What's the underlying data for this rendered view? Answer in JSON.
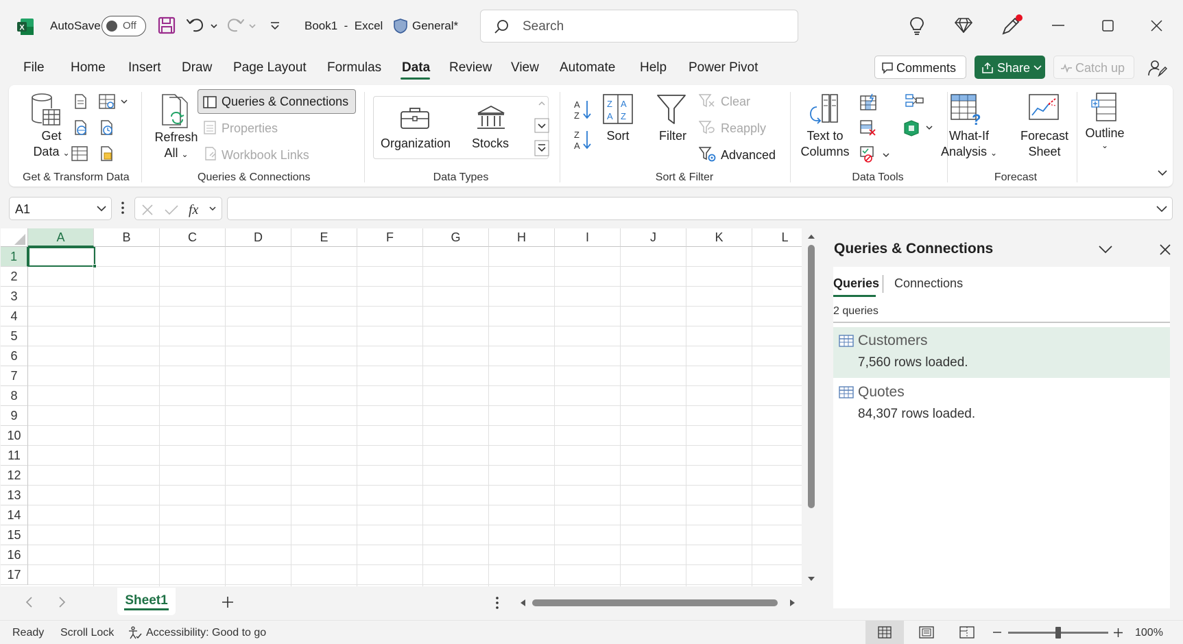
{
  "titlebar": {
    "autosave_label": "AutoSave",
    "autosave_state": "Off",
    "doc_title": "Book1  -  Excel",
    "sensitivity_label": "General*",
    "search_placeholder": "Search"
  },
  "menu": {
    "tabs": [
      "File",
      "Home",
      "Insert",
      "Draw",
      "Page Layout",
      "Formulas",
      "Data",
      "Review",
      "View",
      "Automate",
      "Help",
      "Power Pivot"
    ],
    "active_tab": "Data",
    "comments_label": "Comments",
    "share_label": "Share",
    "catchup_label": "Catch up"
  },
  "ribbon": {
    "get_data_line1": "Get",
    "get_data_line2": "Data",
    "refresh_line1": "Refresh",
    "refresh_line2": "All",
    "queries_connections": "Queries & Connections",
    "properties": "Properties",
    "workbook_links": "Workbook Links",
    "organization": "Organization",
    "stocks": "Stocks",
    "sort": "Sort",
    "filter": "Filter",
    "clear": "Clear",
    "reapply": "Reapply",
    "advanced": "Advanced",
    "text_to_columns_line1": "Text to",
    "text_to_columns_line2": "Columns",
    "whatif_line1": "What-If",
    "whatif_line2": "Analysis",
    "forecast_line1": "Forecast",
    "forecast_line2": "Sheet",
    "outline": "Outline",
    "groups": {
      "get_transform": "Get & Transform Data",
      "queries_connections": "Queries & Connections",
      "data_types": "Data Types",
      "sort_filter": "Sort & Filter",
      "data_tools": "Data Tools",
      "forecast": "Forecast"
    }
  },
  "formula_bar": {
    "name_box": "A1",
    "formula": ""
  },
  "grid": {
    "columns": [
      "A",
      "B",
      "C",
      "D",
      "E",
      "F",
      "G",
      "H",
      "I",
      "J",
      "K",
      "L"
    ],
    "rows": [
      "1",
      "2",
      "3",
      "4",
      "5",
      "6",
      "7",
      "8",
      "9",
      "10",
      "11",
      "12",
      "13",
      "14",
      "15",
      "16",
      "17"
    ],
    "selected_cell": "A1"
  },
  "sheets": {
    "tabs": [
      "Sheet1"
    ],
    "active": "Sheet1"
  },
  "pane": {
    "title": "Queries & Connections",
    "tab_queries": "Queries",
    "tab_connections": "Connections",
    "count_label": "2 queries",
    "queries": [
      {
        "name": "Customers",
        "rows": "7,560 rows loaded."
      },
      {
        "name": "Quotes",
        "rows": "84,307 rows loaded."
      }
    ]
  },
  "statusbar": {
    "ready": "Ready",
    "scroll_lock": "Scroll Lock",
    "accessibility": "Accessibility: Good to go",
    "zoom": "100%"
  },
  "colors": {
    "excel_green": "#1e7145",
    "selection_fill": "#d2e8d9",
    "share_button": "#1e7145",
    "save_icon": "#9b2d8d"
  }
}
